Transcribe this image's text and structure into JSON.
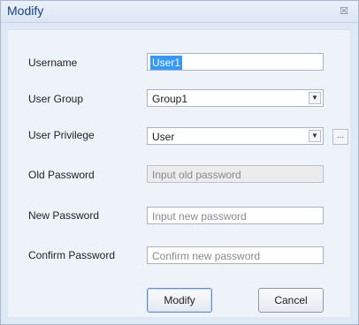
{
  "dialog": {
    "title": "Modify",
    "close_glyph": "☒",
    "close_icon": "close-icon"
  },
  "form": {
    "username": {
      "label": "Username",
      "value": "User1"
    },
    "user_group": {
      "label": "User Group",
      "value": "Group1"
    },
    "user_privilege": {
      "label": "User Privilege",
      "value": "User",
      "more_label": "..."
    },
    "old_password": {
      "label": "Old Password",
      "placeholder": "Input old password"
    },
    "new_password": {
      "label": "New Password",
      "placeholder": "Input new password"
    },
    "confirm_password": {
      "label": "Confirm Password",
      "placeholder": "Confirm new password"
    }
  },
  "buttons": {
    "modify": "Modify",
    "cancel": "Cancel"
  },
  "colors": {
    "title_text": "#15428b",
    "selection": "#3399ff",
    "panel_bg": "#eef3f9"
  }
}
